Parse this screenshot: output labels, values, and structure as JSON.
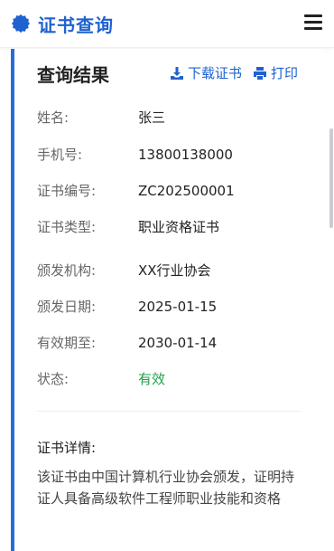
{
  "header": {
    "app_title": "证书查询",
    "logo_icon": "gear-badge-icon",
    "menu_icon": "hamburger-menu-icon",
    "brand_color": "#1e62d0"
  },
  "result": {
    "title": "查询结果",
    "download_label": "下载证书",
    "print_label": "打印",
    "fields": [
      {
        "label": "姓名:",
        "value": "张三"
      },
      {
        "label": "手机号:",
        "value": "13800138000"
      },
      {
        "label": "证书编号:",
        "value": "ZC202500001"
      },
      {
        "label": "证书类型:",
        "value": "职业资格证书"
      },
      {
        "label": "颁发机构:",
        "value": "XX行业协会"
      },
      {
        "label": "颁发日期:",
        "value": "2025-01-15"
      },
      {
        "label": "有效期至:",
        "value": "2030-01-14"
      },
      {
        "label": "状态:",
        "value": "有效"
      }
    ],
    "status_color": "#22a04a",
    "detail_label": "证书详情:",
    "detail_text": "该证书由中国计算机行业协会颁发，证明持证人具备高级软件工程师职业技能和资格"
  }
}
